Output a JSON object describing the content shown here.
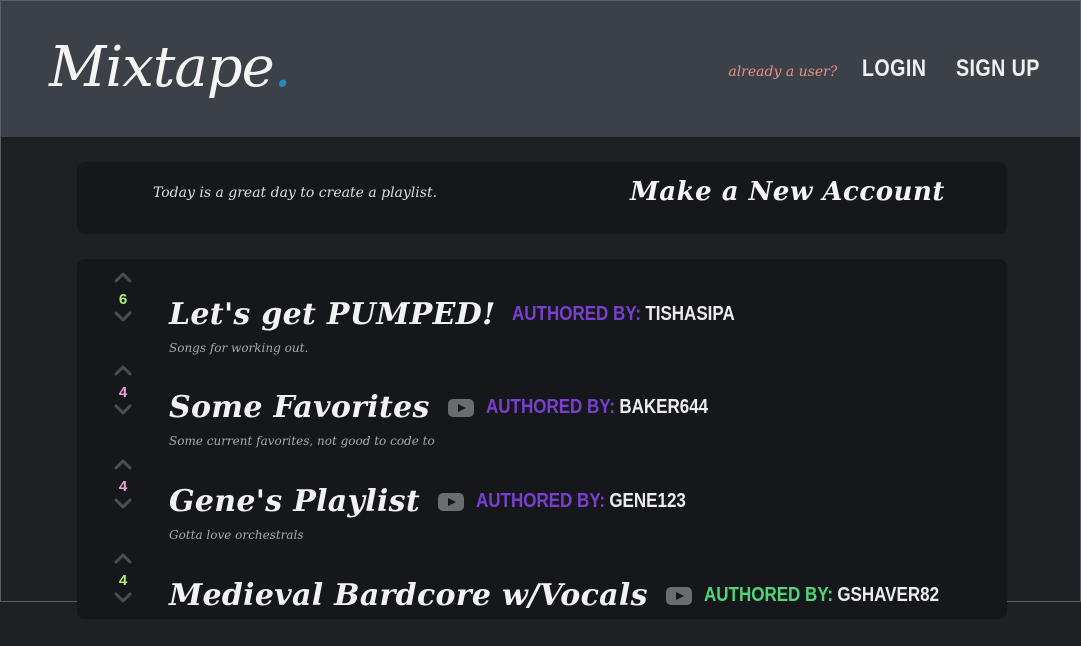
{
  "header": {
    "logo_text": "Mixtape",
    "logo_dot": ".",
    "prompt": "already a user?",
    "login_label": "LOGIN",
    "signup_label": "SIGN UP"
  },
  "banner": {
    "message": "Today is a great day to create a playlist.",
    "cta_label": "Make a New Account"
  },
  "playlists": [
    {
      "title": "Let's get PUMPED!",
      "votes": "6",
      "vote_color": "#a8f07a",
      "has_youtube": false,
      "author_label": "AUTHORED BY:",
      "author_label_color": "#7a3fd1",
      "author": "TISHASIPA",
      "description": "Songs for working out."
    },
    {
      "title": "Some Favorites",
      "votes": "4",
      "vote_color": "#f0a0d8",
      "has_youtube": true,
      "author_label": "AUTHORED BY:",
      "author_label_color": "#7a3fd1",
      "author": "BAKER644",
      "description": "Some current favorites, not good to code to"
    },
    {
      "title": "Gene's Playlist",
      "votes": "4",
      "vote_color": "#f0a0d8",
      "has_youtube": true,
      "author_label": "AUTHORED BY:",
      "author_label_color": "#7a3fd1",
      "author": "GENE123",
      "description": "Gotta love orchestrals"
    },
    {
      "title": "Medieval Bardcore w/Vocals",
      "votes": "4",
      "vote_color": "#a8f07a",
      "has_youtube": true,
      "author_label": "AUTHORED BY:",
      "author_label_color": "#4fd67a",
      "author": "GSHAVER82",
      "description": ""
    }
  ],
  "icons": {
    "upvote": "chevron-up-icon",
    "downvote": "chevron-down-icon",
    "youtube": "youtube-icon"
  }
}
